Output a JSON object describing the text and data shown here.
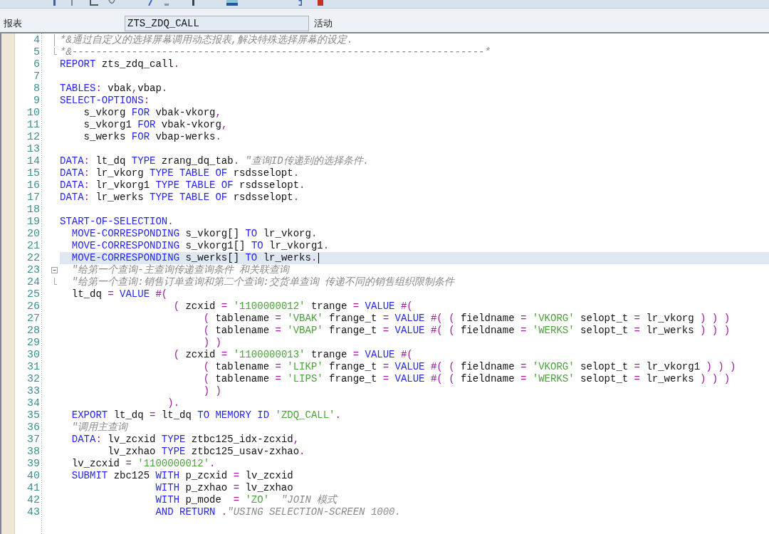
{
  "header": {
    "label": "报表",
    "program_field": {
      "value": "ZTS_ZDQ_CALL"
    },
    "status": "活动"
  },
  "editor": {
    "lines": [
      {
        "number": "4",
        "fold": {
          "kind": "middle"
        },
        "selected": false,
        "tokens": [
          {
            "kind": "comment",
            "text": "*&通过自定义的选择屏幕调用动态报表,解决特殊选择屏幕的设定."
          }
        ]
      },
      {
        "number": "5",
        "fold": {
          "kind": "end"
        },
        "selected": false,
        "tokens": [
          {
            "kind": "comment",
            "text": "*&---------------------------------------------------------------------*"
          }
        ]
      },
      {
        "number": "6",
        "selected": false,
        "tokens": [
          {
            "kind": "keyword",
            "text": "REPORT"
          },
          {
            "kind": "plain",
            "text": " zts_zdq_call"
          },
          {
            "kind": "operator",
            "text": "."
          }
        ]
      },
      {
        "number": "7",
        "selected": false
      },
      {
        "number": "8",
        "selected": false,
        "tokens": [
          {
            "kind": "keyword",
            "text": "TABLES"
          },
          {
            "kind": "operator",
            "text": ":"
          },
          {
            "kind": "plain",
            "text": " vbak"
          },
          {
            "kind": "operator",
            "text": ","
          },
          {
            "kind": "plain",
            "text": "vbap"
          },
          {
            "kind": "operator",
            "text": "."
          }
        ]
      },
      {
        "number": "9",
        "selected": false,
        "tokens": [
          {
            "kind": "keyword",
            "text": "SELECT-OPTIONS"
          },
          {
            "kind": "operator",
            "text": ":"
          }
        ]
      },
      {
        "number": "10",
        "selected": false,
        "tokens": [
          {
            "kind": "plain",
            "text": "    s_vkorg "
          },
          {
            "kind": "keyword",
            "text": "FOR"
          },
          {
            "kind": "plain",
            "text": " vbak-vkorg"
          },
          {
            "kind": "operator",
            "text": ","
          }
        ]
      },
      {
        "number": "11",
        "selected": false,
        "tokens": [
          {
            "kind": "plain",
            "text": "    s_vkorg1 "
          },
          {
            "kind": "keyword",
            "text": "FOR"
          },
          {
            "kind": "plain",
            "text": " vbak-vkorg"
          },
          {
            "kind": "operator",
            "text": ","
          }
        ]
      },
      {
        "number": "12",
        "selected": false,
        "tokens": [
          {
            "kind": "plain",
            "text": "    s_werks "
          },
          {
            "kind": "keyword",
            "text": "FOR"
          },
          {
            "kind": "plain",
            "text": " vbap-werks"
          },
          {
            "kind": "operator",
            "text": "."
          }
        ]
      },
      {
        "number": "13",
        "selected": false
      },
      {
        "number": "14",
        "selected": false,
        "tokens": [
          {
            "kind": "keyword",
            "text": "DATA"
          },
          {
            "kind": "operator",
            "text": ":"
          },
          {
            "kind": "plain",
            "text": " lt_dq "
          },
          {
            "kind": "keyword",
            "text": "TYPE"
          },
          {
            "kind": "plain",
            "text": " zrang_dq_tab"
          },
          {
            "kind": "operator",
            "text": "."
          },
          {
            "kind": "comment",
            "text": " \"查询ID传递到的选择条件."
          }
        ]
      },
      {
        "number": "15",
        "selected": false,
        "tokens": [
          {
            "kind": "keyword",
            "text": "DATA"
          },
          {
            "kind": "operator",
            "text": ":"
          },
          {
            "kind": "plain",
            "text": " lr_vkorg "
          },
          {
            "kind": "keyword",
            "text": "TYPE TABLE OF"
          },
          {
            "kind": "plain",
            "text": " rsdsselopt"
          },
          {
            "kind": "operator",
            "text": "."
          }
        ]
      },
      {
        "number": "16",
        "selected": false,
        "tokens": [
          {
            "kind": "keyword",
            "text": "DATA"
          },
          {
            "kind": "operator",
            "text": ":"
          },
          {
            "kind": "plain",
            "text": " lr_vkorg1 "
          },
          {
            "kind": "keyword",
            "text": "TYPE TABLE OF"
          },
          {
            "kind": "plain",
            "text": " rsdsselopt"
          },
          {
            "kind": "operator",
            "text": "."
          }
        ]
      },
      {
        "number": "17",
        "selected": false,
        "tokens": [
          {
            "kind": "keyword",
            "text": "DATA"
          },
          {
            "kind": "operator",
            "text": ":"
          },
          {
            "kind": "plain",
            "text": " lr_werks "
          },
          {
            "kind": "keyword",
            "text": "TYPE TABLE OF"
          },
          {
            "kind": "plain",
            "text": " rsdsselopt"
          },
          {
            "kind": "operator",
            "text": "."
          }
        ]
      },
      {
        "number": "18",
        "selected": false
      },
      {
        "number": "19",
        "selected": false,
        "tokens": [
          {
            "kind": "keyword",
            "text": "START-OF-SELECTION"
          },
          {
            "kind": "operator",
            "text": "."
          }
        ]
      },
      {
        "number": "20",
        "selected": false,
        "tokens": [
          {
            "kind": "keyword",
            "text": "  MOVE-CORRESPONDING"
          },
          {
            "kind": "plain",
            "text": " s_vkorg[] "
          },
          {
            "kind": "keyword",
            "text": "TO"
          },
          {
            "kind": "plain",
            "text": " lr_vkorg"
          },
          {
            "kind": "operator",
            "text": "."
          }
        ]
      },
      {
        "number": "21",
        "selected": false,
        "tokens": [
          {
            "kind": "keyword",
            "text": "  MOVE-CORRESPONDING"
          },
          {
            "kind": "plain",
            "text": " s_vkorg1[] "
          },
          {
            "kind": "keyword",
            "text": "TO"
          },
          {
            "kind": "plain",
            "text": " lr_vkorg1"
          },
          {
            "kind": "operator",
            "text": "."
          }
        ]
      },
      {
        "number": "22",
        "selected": true,
        "tokens": [
          {
            "kind": "keyword",
            "text": "  MOVE-CORRESPONDING"
          },
          {
            "kind": "plain",
            "text": " s_werks[] "
          },
          {
            "kind": "keyword",
            "text": "TO"
          },
          {
            "kind": "plain",
            "text": " lr_werks"
          },
          {
            "kind": "operator",
            "text": "."
          }
        ]
      },
      {
        "number": "23",
        "fold": {
          "kind": "start",
          "expanded": true
        },
        "selected": false,
        "tokens": [
          {
            "kind": "comment",
            "text": "  \"给第一个查询-主查询传递查询条件 和关联查询"
          }
        ]
      },
      {
        "number": "24",
        "fold": {
          "kind": "end"
        },
        "selected": false,
        "tokens": [
          {
            "kind": "comment",
            "text": "  \"给第一个查询:销售订单查询和第二个查询:交货单查询 传递不同的销售组织限制条件"
          }
        ]
      },
      {
        "number": "25",
        "selected": false,
        "tokens": [
          {
            "kind": "plain",
            "text": "  lt_dq "
          },
          {
            "kind": "operator",
            "text": "="
          },
          {
            "kind": "keyword",
            "text": " VALUE"
          },
          {
            "kind": "operator",
            "text": " #("
          }
        ]
      },
      {
        "number": "26",
        "selected": false,
        "tokens": [
          {
            "kind": "operator",
            "text": "                   ("
          },
          {
            "kind": "plain",
            "text": " zcxid "
          },
          {
            "kind": "operator",
            "text": "="
          },
          {
            "kind": "string",
            "text": " '1100000012'"
          },
          {
            "kind": "plain",
            "text": " trange "
          },
          {
            "kind": "operator",
            "text": "="
          },
          {
            "kind": "keyword",
            "text": " VALUE"
          },
          {
            "kind": "operator",
            "text": " #("
          }
        ]
      },
      {
        "number": "27",
        "selected": false,
        "tokens": [
          {
            "kind": "operator",
            "text": "                        ("
          },
          {
            "kind": "plain",
            "text": " tablename "
          },
          {
            "kind": "operator",
            "text": "="
          },
          {
            "kind": "string",
            "text": " 'VBAK'"
          },
          {
            "kind": "plain",
            "text": " frange_t "
          },
          {
            "kind": "operator",
            "text": "="
          },
          {
            "kind": "keyword",
            "text": " VALUE"
          },
          {
            "kind": "operator",
            "text": " #( ("
          },
          {
            "kind": "plain",
            "text": " fieldname "
          },
          {
            "kind": "operator",
            "text": "="
          },
          {
            "kind": "string",
            "text": " 'VKORG'"
          },
          {
            "kind": "plain",
            "text": " selopt_t "
          },
          {
            "kind": "operator",
            "text": "="
          },
          {
            "kind": "plain",
            "text": " lr_vkorg "
          },
          {
            "kind": "operator",
            "text": ") ) )"
          }
        ]
      },
      {
        "number": "28",
        "selected": false,
        "tokens": [
          {
            "kind": "operator",
            "text": "                        ("
          },
          {
            "kind": "plain",
            "text": " tablename "
          },
          {
            "kind": "operator",
            "text": "="
          },
          {
            "kind": "string",
            "text": " 'VBAP'"
          },
          {
            "kind": "plain",
            "text": " frange_t "
          },
          {
            "kind": "operator",
            "text": "="
          },
          {
            "kind": "keyword",
            "text": " VALUE"
          },
          {
            "kind": "operator",
            "text": " #( ("
          },
          {
            "kind": "plain",
            "text": " fieldname "
          },
          {
            "kind": "operator",
            "text": "="
          },
          {
            "kind": "string",
            "text": " 'WERKS'"
          },
          {
            "kind": "plain",
            "text": " selopt_t "
          },
          {
            "kind": "operator",
            "text": "="
          },
          {
            "kind": "plain",
            "text": " lr_werks "
          },
          {
            "kind": "operator",
            "text": ") ) )"
          }
        ]
      },
      {
        "number": "29",
        "selected": false,
        "tokens": [
          {
            "kind": "operator",
            "text": "                        ) )"
          }
        ]
      },
      {
        "number": "30",
        "selected": false,
        "tokens": [
          {
            "kind": "operator",
            "text": "                   ("
          },
          {
            "kind": "plain",
            "text": " zcxid "
          },
          {
            "kind": "operator",
            "text": "="
          },
          {
            "kind": "string",
            "text": " '1100000013'"
          },
          {
            "kind": "plain",
            "text": " trange "
          },
          {
            "kind": "operator",
            "text": "="
          },
          {
            "kind": "keyword",
            "text": " VALUE"
          },
          {
            "kind": "operator",
            "text": " #("
          }
        ]
      },
      {
        "number": "31",
        "selected": false,
        "tokens": [
          {
            "kind": "operator",
            "text": "                        ("
          },
          {
            "kind": "plain",
            "text": " tablename "
          },
          {
            "kind": "operator",
            "text": "="
          },
          {
            "kind": "string",
            "text": " 'LIKP'"
          },
          {
            "kind": "plain",
            "text": " frange_t "
          },
          {
            "kind": "operator",
            "text": "="
          },
          {
            "kind": "keyword",
            "text": " VALUE"
          },
          {
            "kind": "operator",
            "text": " #( ("
          },
          {
            "kind": "plain",
            "text": " fieldname "
          },
          {
            "kind": "operator",
            "text": "="
          },
          {
            "kind": "string",
            "text": " 'VKORG'"
          },
          {
            "kind": "plain",
            "text": " selopt_t "
          },
          {
            "kind": "operator",
            "text": "="
          },
          {
            "kind": "plain",
            "text": " lr_vkorg1 "
          },
          {
            "kind": "operator",
            "text": ") ) )"
          }
        ]
      },
      {
        "number": "32",
        "selected": false,
        "tokens": [
          {
            "kind": "operator",
            "text": "                        ("
          },
          {
            "kind": "plain",
            "text": " tablename "
          },
          {
            "kind": "operator",
            "text": "="
          },
          {
            "kind": "string",
            "text": " 'LIPS'"
          },
          {
            "kind": "plain",
            "text": " frange_t "
          },
          {
            "kind": "operator",
            "text": "="
          },
          {
            "kind": "keyword",
            "text": " VALUE"
          },
          {
            "kind": "operator",
            "text": " #( ("
          },
          {
            "kind": "plain",
            "text": " fieldname "
          },
          {
            "kind": "operator",
            "text": "="
          },
          {
            "kind": "string",
            "text": " 'WERKS'"
          },
          {
            "kind": "plain",
            "text": " selopt_t "
          },
          {
            "kind": "operator",
            "text": "="
          },
          {
            "kind": "plain",
            "text": " lr_werks "
          },
          {
            "kind": "operator",
            "text": ") ) )"
          }
        ]
      },
      {
        "number": "33",
        "selected": false,
        "tokens": [
          {
            "kind": "operator",
            "text": "                        ) )"
          }
        ]
      },
      {
        "number": "34",
        "selected": false,
        "tokens": [
          {
            "kind": "operator",
            "text": "                  )."
          }
        ]
      },
      {
        "number": "35",
        "selected": false,
        "tokens": [
          {
            "kind": "keyword",
            "text": "  EXPORT"
          },
          {
            "kind": "plain",
            "text": " lt_dq "
          },
          {
            "kind": "operator",
            "text": "="
          },
          {
            "kind": "plain",
            "text": " lt_dq "
          },
          {
            "kind": "keyword",
            "text": "TO MEMORY ID"
          },
          {
            "kind": "string",
            "text": " 'ZDQ_CALL'"
          },
          {
            "kind": "operator",
            "text": "."
          }
        ]
      },
      {
        "number": "36",
        "selected": false,
        "tokens": [
          {
            "kind": "comment",
            "text": "  \"调用主查询"
          }
        ]
      },
      {
        "number": "37",
        "selected": false,
        "tokens": [
          {
            "kind": "keyword",
            "text": "  DATA"
          },
          {
            "kind": "operator",
            "text": ":"
          },
          {
            "kind": "plain",
            "text": " lv_zcxid "
          },
          {
            "kind": "keyword",
            "text": "TYPE"
          },
          {
            "kind": "plain",
            "text": " ztbc125_idx-zcxid"
          },
          {
            "kind": "operator",
            "text": ","
          }
        ]
      },
      {
        "number": "38",
        "selected": false,
        "tokens": [
          {
            "kind": "plain",
            "text": "        lv_zxhao "
          },
          {
            "kind": "keyword",
            "text": "TYPE"
          },
          {
            "kind": "plain",
            "text": " ztbc125_usav-zxhao"
          },
          {
            "kind": "operator",
            "text": "."
          }
        ]
      },
      {
        "number": "39",
        "selected": false,
        "tokens": [
          {
            "kind": "plain",
            "text": "  lv_zcxid "
          },
          {
            "kind": "operator",
            "text": "="
          },
          {
            "kind": "string",
            "text": " '1100000012'"
          },
          {
            "kind": "operator",
            "text": "."
          }
        ]
      },
      {
        "number": "40",
        "selected": false,
        "tokens": [
          {
            "kind": "keyword",
            "text": "  SUBMIT"
          },
          {
            "kind": "plain",
            "text": " zbc125 "
          },
          {
            "kind": "keyword",
            "text": "WITH"
          },
          {
            "kind": "plain",
            "text": " p_zcxid "
          },
          {
            "kind": "operator",
            "text": "="
          },
          {
            "kind": "plain",
            "text": " lv_zcxid"
          }
        ]
      },
      {
        "number": "41",
        "selected": false,
        "tokens": [
          {
            "kind": "keyword",
            "text": "                WITH"
          },
          {
            "kind": "plain",
            "text": " p_zxhao "
          },
          {
            "kind": "operator",
            "text": "="
          },
          {
            "kind": "plain",
            "text": " lv_zxhao"
          }
        ]
      },
      {
        "number": "42",
        "selected": false,
        "tokens": [
          {
            "kind": "keyword",
            "text": "                WITH"
          },
          {
            "kind": "plain",
            "text": " p_mode  "
          },
          {
            "kind": "operator",
            "text": "="
          },
          {
            "kind": "string",
            "text": " 'ZO'"
          },
          {
            "kind": "comment",
            "text": "  \"JOIN 模式"
          }
        ]
      },
      {
        "number": "43",
        "selected": false,
        "tokens": [
          {
            "kind": "keyword",
            "text": "                AND RETURN"
          },
          {
            "kind": "operator",
            "text": " ."
          },
          {
            "kind": "comment",
            "text": "\"USING SELECTION-SCREEN 1000."
          }
        ]
      }
    ]
  }
}
